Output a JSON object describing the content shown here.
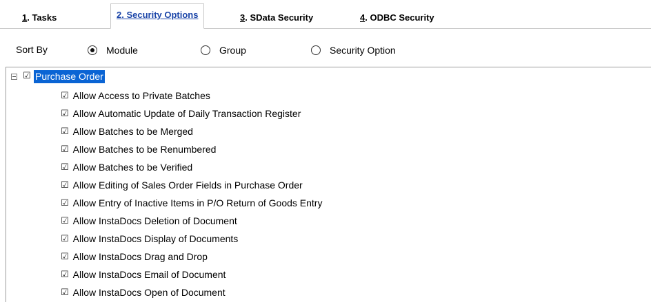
{
  "tabs": [
    {
      "key": "1",
      "rest": ". Tasks",
      "active": false
    },
    {
      "key": "2",
      "rest": ". Security Options",
      "active": true
    },
    {
      "key": "3",
      "rest": ". SData Security",
      "active": false
    },
    {
      "key": "4",
      "rest": ". ODBC Security",
      "active": false
    }
  ],
  "sort": {
    "label": "Sort By",
    "options": [
      {
        "label": "Module",
        "selected": true
      },
      {
        "label": "Group",
        "selected": false
      },
      {
        "label": "Security Option",
        "selected": false
      }
    ]
  },
  "tree": {
    "root": {
      "label": "Purchase Order",
      "checked": true,
      "expanded": true
    },
    "items": [
      {
        "label": "Allow Access to Private Batches",
        "checked": true
      },
      {
        "label": "Allow Automatic Update of Daily Transaction Register",
        "checked": true
      },
      {
        "label": "Allow Batches to be Merged",
        "checked": true
      },
      {
        "label": "Allow Batches to be Renumbered",
        "checked": true
      },
      {
        "label": "Allow Batches to be Verified",
        "checked": true
      },
      {
        "label": "Allow Editing of Sales Order Fields in Purchase Order",
        "checked": true
      },
      {
        "label": "Allow Entry of Inactive Items in P/O Return of Goods Entry",
        "checked": true
      },
      {
        "label": "Allow InstaDocs Deletion of Document",
        "checked": true
      },
      {
        "label": "Allow InstaDocs Display of Documents",
        "checked": true
      },
      {
        "label": "Allow InstaDocs Drag and Drop",
        "checked": true
      },
      {
        "label": "Allow InstaDocs Email of Document",
        "checked": true
      },
      {
        "label": "Allow InstaDocs Open of Document",
        "checked": true
      }
    ]
  },
  "icons": {
    "checkbox_checked": "☑",
    "collapse": "minus-box"
  }
}
